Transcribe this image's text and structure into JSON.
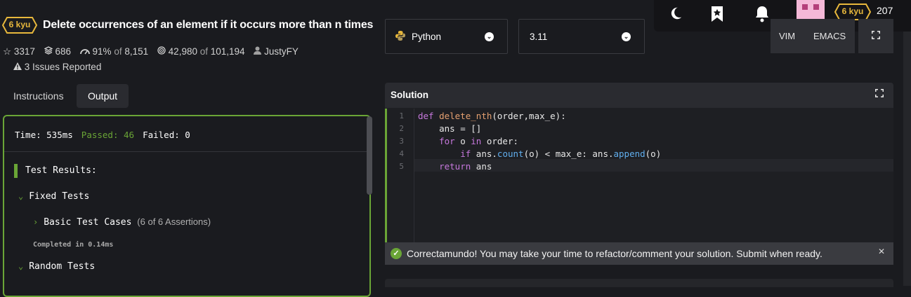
{
  "kata": {
    "rank": "6 kyu",
    "title": "Delete occurrences of an element if it occurs more than n times",
    "stars": "3317",
    "collections": "686",
    "satisfaction": "91%",
    "satisfaction_of_label": "of",
    "votes": "8,151",
    "completed": "42,980",
    "completed_of_label": "of",
    "attempted": "101,194",
    "author": "JustyFY",
    "issues": "3 Issues Reported"
  },
  "tabs": [
    {
      "label": "Instructions",
      "active": false
    },
    {
      "label": "Output",
      "active": true
    }
  ],
  "output": {
    "time": "Time: 535ms",
    "passed": "Passed: 46",
    "failed": "Failed: 0",
    "results_title": "Test Results:",
    "groups": [
      {
        "label": "Fixed Tests",
        "expanded": true
      },
      {
        "label": "Basic Test Cases",
        "assertions": "(6 of 6 Assertions)",
        "expanded": false
      },
      {
        "label": "Random Tests",
        "expanded": true
      }
    ],
    "completed_in": "Completed in 0.14ms"
  },
  "editor_settings": {
    "language": "Python",
    "version": "3.11",
    "modes": [
      "VIM",
      "EMACS"
    ]
  },
  "solution": {
    "title": "Solution",
    "line_numbers": [
      "1",
      "2",
      "3",
      "4",
      "5"
    ]
  },
  "banner": {
    "message": "Correctamundo! You may take your time to refactor/comment your solution. Submit when ready."
  },
  "user": {
    "rank": "6 kyu",
    "honor": "207"
  },
  "colors": {
    "success": "#6aa536",
    "rank_yellow": "#e8b83c",
    "background": "#1a1b1f"
  }
}
